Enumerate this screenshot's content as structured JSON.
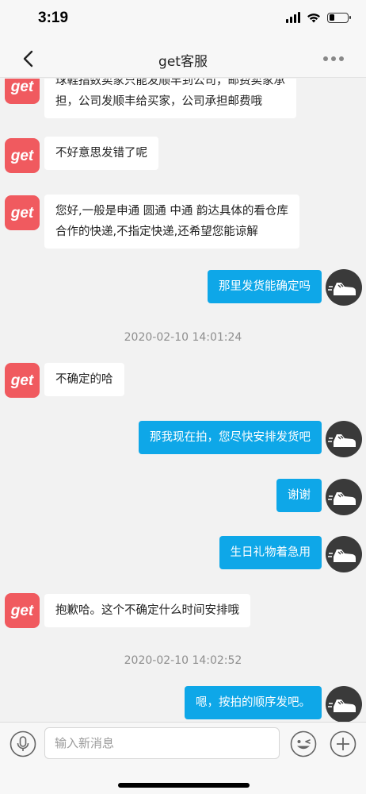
{
  "status_bar": {
    "time": "3:19",
    "battery_level": 0.3
  },
  "nav": {
    "title": "get客服",
    "back_icon": "chevron-left-icon",
    "more_icon": "more-dots-icon"
  },
  "messages": [
    {
      "side": "left",
      "lines": [
        "球鞋指数卖家只能发顺丰到公司，邮费卖家承",
        "担，公司发顺丰给买家，公司承担邮费哦"
      ]
    },
    {
      "side": "left",
      "lines": [
        "不好意思发错了呢"
      ]
    },
    {
      "side": "left",
      "lines": [
        "您好,一般是申通 圆通 中通  韵达具体的看仓库",
        "合作的快递,不指定快递,还希望您能谅解"
      ]
    },
    {
      "side": "right",
      "lines": [
        "那里发货能确定吗"
      ]
    },
    {
      "timestamp": "2020-02-10 14:01:24"
    },
    {
      "side": "left",
      "lines": [
        "不确定的哈"
      ]
    },
    {
      "side": "right",
      "lines": [
        "那我现在拍，您尽快安排发货吧"
      ]
    },
    {
      "side": "right",
      "lines": [
        "谢谢"
      ]
    },
    {
      "side": "right",
      "lines": [
        "生日礼物着急用"
      ]
    },
    {
      "side": "left",
      "lines": [
        "抱歉哈。这个不确定什么时间安排哦"
      ]
    },
    {
      "timestamp": "2020-02-10 14:02:52"
    },
    {
      "side": "right",
      "lines": [
        "嗯，按拍的顺序发吧。"
      ]
    }
  ],
  "agent_avatar_text": "get",
  "input_bar": {
    "placeholder": "输入新消息",
    "voice_icon": "microphone-icon",
    "emoji_icon": "emoji-icon",
    "plus_icon": "plus-icon"
  },
  "colors": {
    "accent_bubble": "#0ea7e8",
    "agent_avatar": "#f05a5f",
    "user_avatar": "#3a3a3a"
  }
}
